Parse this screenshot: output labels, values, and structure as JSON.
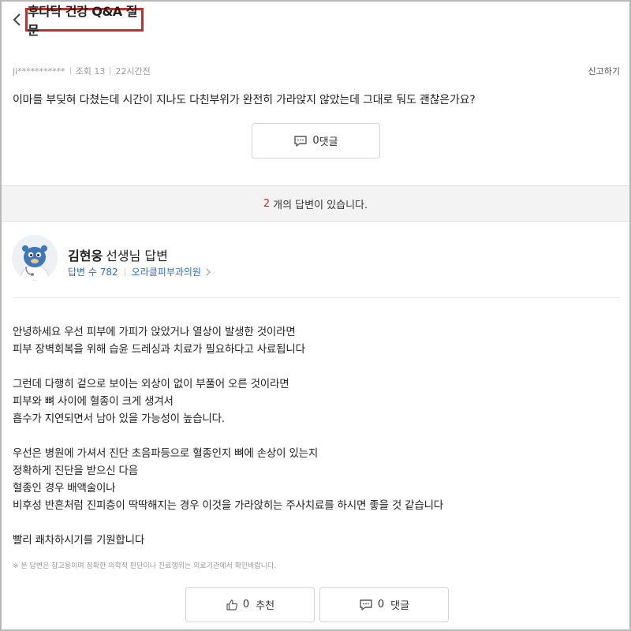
{
  "header": {
    "title": "후다닥 건강 Q&A 질문"
  },
  "question": {
    "author": "ji***********",
    "views": "조회 13",
    "time": "22시간전",
    "report_label": "신고하기",
    "text": "이마를 부딪혀 다쳤는데 시간이 지나도 다친부위가 완전히 가라앉지 않았는데 그대로 둬도 괜찮은가요?",
    "comment_count": "0",
    "comment_label": "댓글"
  },
  "answers_band": {
    "count": "2",
    "text": "개의 답변이 있습니다."
  },
  "answer": {
    "doctor_name": "김현웅",
    "doctor_suffix": "선생님 답변",
    "answer_count": "답변 수 782",
    "clinic": "오라클피부과의원",
    "lines": [
      "안녕하세요 우선 피부에 가피가 앉았거나 열상이 발생한 것이라면",
      "피부 장벽회복을 위해 습윤 드레싱과 치료가 필요하다고 사료됩니다",
      "",
      "그런데 다행히 겉으로 보이는 외상이 없이 부풀어 오른 것이라면",
      "피부와 뼈 사이에 혈종이 크게 생겨서",
      "흡수가 지연되면서 남아 있을 가능성이 높습니다.",
      "",
      "우선은 병원에 가셔서 진단 초음파등으로 혈종인지 뼈에 손상이 있는지",
      "정확하게 진단을 받으신 다음",
      "혈종인 경우 배액술이나",
      "비후성 반흔처럼 진피층이 딱딱해지는 경우 이것을 가라앉히는 주사치료를 하시면 좋을 것 같습니다",
      "",
      "빨리 쾌차하시기를 기원합니다"
    ],
    "disclaimer": "※ 본 답변은 참고용이며 정확한 의학적 판단이나 진료행위는 의료기관에서 확인바랍니다.",
    "like_count": "0",
    "like_label": "추천",
    "comment_count": "0",
    "comment_label": "댓글"
  },
  "icons": {
    "back": "chevron-left-icon",
    "comment": "speech-bubble-icon",
    "like": "thumbs-up-icon",
    "clinic_link": "chevron-right-icon"
  },
  "colors": {
    "title_border": "#c0312b",
    "answer_count_accent": "#d6262c",
    "link_blue": "#2f6db8"
  }
}
